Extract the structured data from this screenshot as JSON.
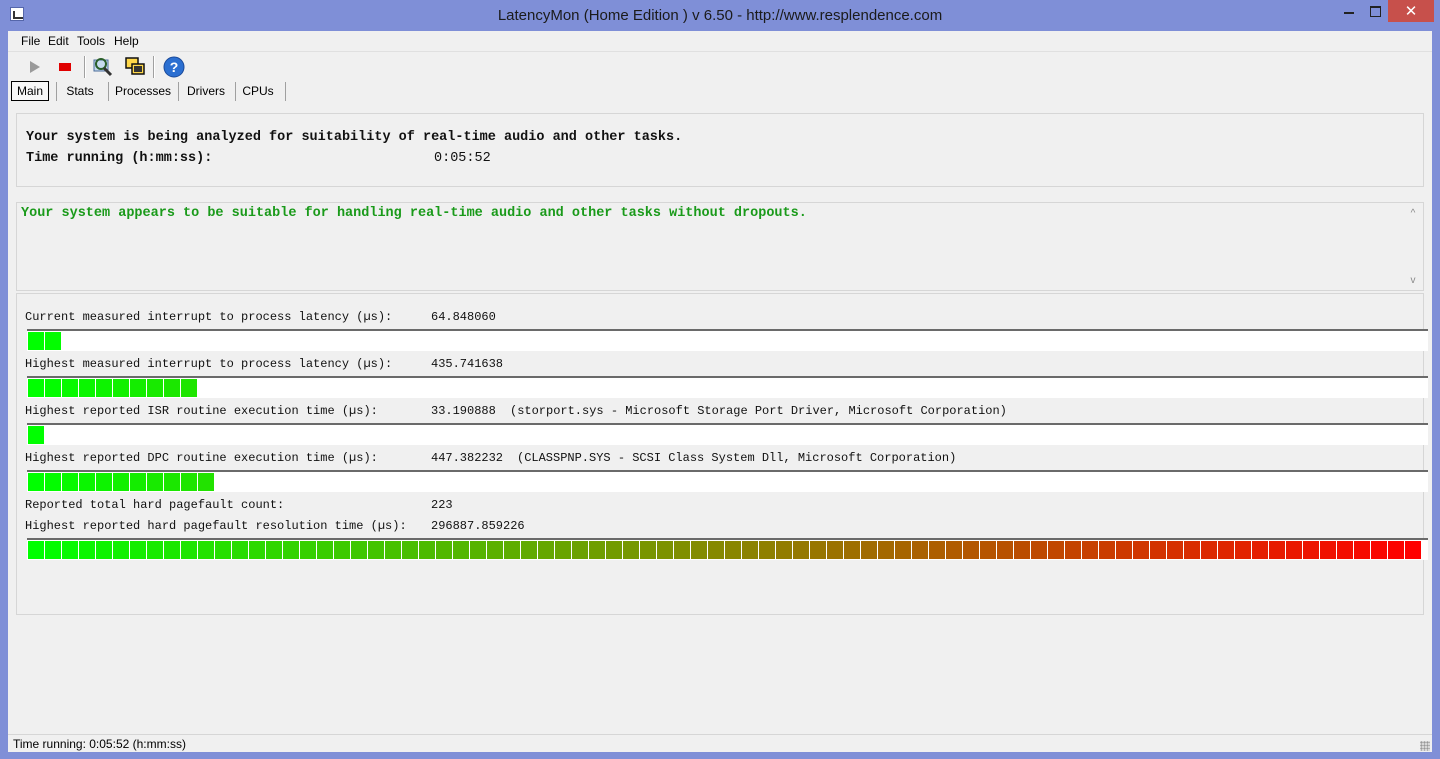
{
  "window": {
    "title": "LatencyMon  (Home Edition )  v 6.50 - http://www.resplendence.com",
    "close_glyph": "✕"
  },
  "menu": [
    "File",
    "Edit",
    "Tools",
    "Help"
  ],
  "toolbar": {
    "icons": [
      "play-icon",
      "stop-icon",
      "search-icon",
      "windows-icon",
      "help-icon"
    ],
    "help_glyph": "?"
  },
  "tabs": [
    "Main",
    "Stats",
    "Processes",
    "Drivers",
    "CPUs"
  ],
  "status_panel": {
    "line1": "Your system is being analyzed for suitability of real-time audio and other tasks.",
    "time_label": "Time running (h:mm:ss):",
    "time_value": "0:05:52"
  },
  "result": {
    "message": "Your system appears to be suitable for handling real-time audio and other tasks without dropouts.",
    "scroll_up_glyph": "^",
    "scroll_down_glyph": "v"
  },
  "metrics": [
    {
      "label": "Current measured interrupt to process latency (µs):",
      "value": "64.848060",
      "extra": "",
      "bar_fraction": 0.024
    },
    {
      "label": "Highest measured interrupt to process latency (µs):",
      "value": "435.741638",
      "extra": "",
      "bar_fraction": 0.12
    },
    {
      "label": "Highest reported ISR routine execution time (µs):",
      "value": "33.190888",
      "extra": "(storport.sys - Microsoft Storage Port Driver, Microsoft Corporation)",
      "bar_fraction": 0.012
    },
    {
      "label": "Highest reported DPC routine execution time (µs):",
      "value": "447.382232",
      "extra": "(CLASSPNP.SYS - SCSI Class System Dll, Microsoft Corporation)",
      "bar_fraction": 0.132
    }
  ],
  "pagefault": {
    "count_label": "Reported total hard pagefault count:",
    "count_value": "223",
    "time_label": "Highest reported hard pagefault resolution time (µs):",
    "time_value": "296887.859226",
    "bar_fraction": 1.0
  },
  "statusbar": {
    "text": "Time running: 0:05:52  (h:mm:ss)"
  },
  "colors": {
    "bar_start": "#00ff00",
    "bar_mid": "#888800",
    "bar_end": "#ff0000"
  }
}
